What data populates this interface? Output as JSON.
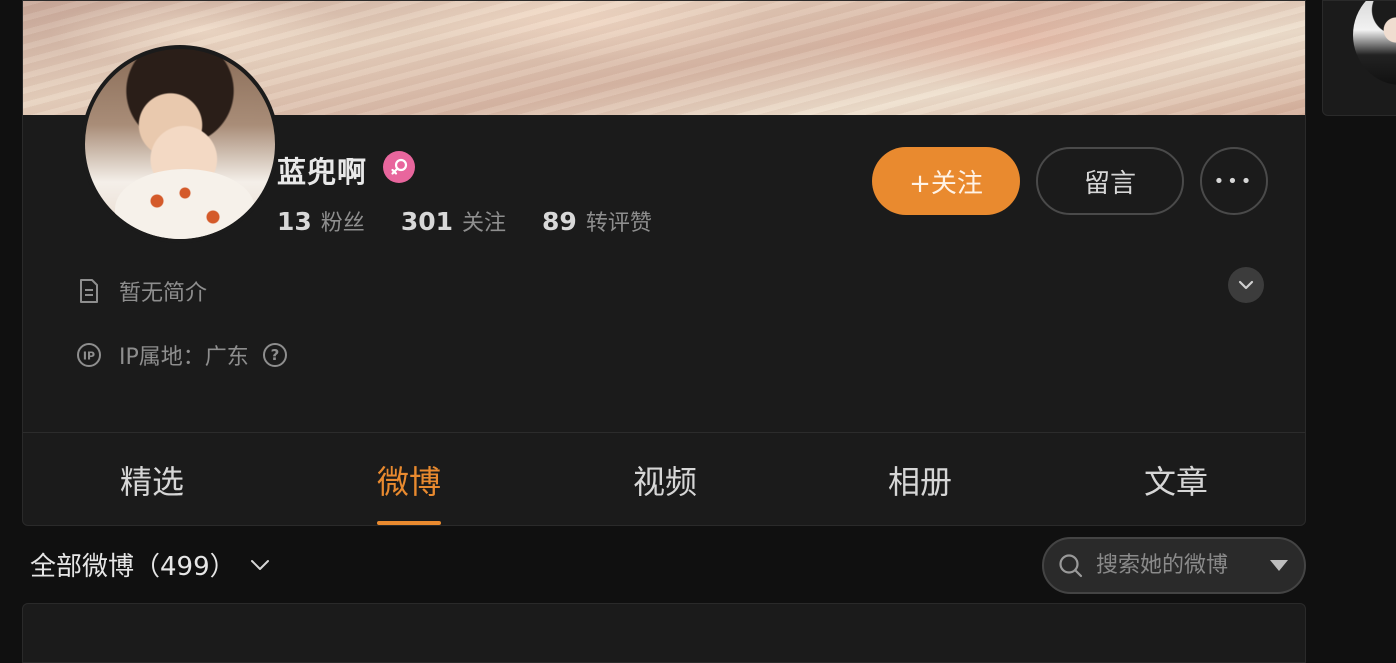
{
  "profile": {
    "name": "蓝兜啊",
    "gender": "female",
    "avatar": "profile-photo",
    "stats": [
      {
        "num": "13",
        "label": "粉丝"
      },
      {
        "num": "301",
        "label": "关注"
      },
      {
        "num": "89",
        "label": "转评赞"
      }
    ],
    "bio": "暂无简介",
    "ip": "IP属地：广东"
  },
  "actions": {
    "follow_label": "+关注",
    "message_label": "留言",
    "more_label": "•••"
  },
  "tabs": [
    {
      "label": "精选",
      "active": false
    },
    {
      "label": "微博",
      "active": true
    },
    {
      "label": "视频",
      "active": false
    },
    {
      "label": "相册",
      "active": false
    },
    {
      "label": "文章",
      "active": false
    }
  ],
  "feed": {
    "filter_label": "全部微博（499）"
  },
  "search": {
    "placeholder": "搜索她的微博"
  },
  "colors": {
    "accent": "#e98a2f",
    "female_badge": "#e8669d",
    "background": "#101010",
    "card": "#1b1b1b"
  }
}
